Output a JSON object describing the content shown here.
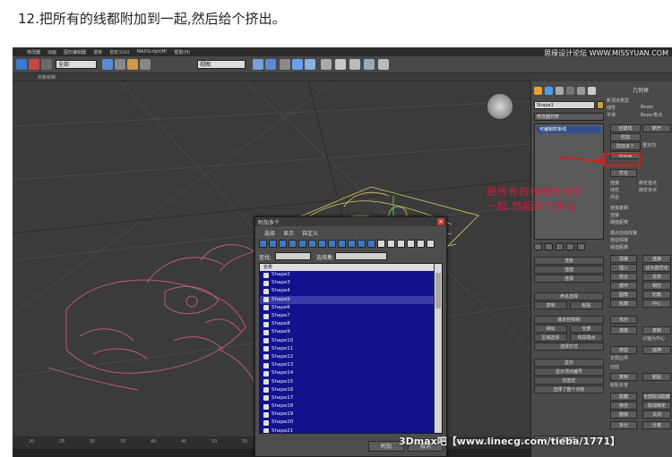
{
  "caption": "12.把所有的线都附加到一起,然后给个挤出。",
  "watermark_top": "思缘设计论坛 WWW.MISSYUAN.COM",
  "watermark_bottom": "3Dmax吧【www.linecg.com/tieba/1771】",
  "annotation": "把所有的线都附加到一起,然后给个挤出",
  "menubar": {
    "items": [
      "修改器",
      "动画",
      "图形编辑器",
      "渲染",
      "自定义(U)",
      "MAXScript(M)",
      "帮助(H)"
    ]
  },
  "toolbar": {
    "select_filter": "全部",
    "view": "视图"
  },
  "subbar": {
    "label": "对象绘制"
  },
  "command_panel": {
    "rollout_title": "几何体",
    "object_name": "Shape1",
    "modifier_list": "修改器列表",
    "stack_item": "可编辑样条线",
    "right_items": [
      "新顶点类型",
      "线性",
      "Bezer",
      "平滑",
      "Bezer角点",
      "创建线",
      "断开",
      "附加",
      "附加多个",
      "重定向",
      "横截面",
      "优化",
      "连接",
      "线性",
      "绑定首点",
      "闭合",
      "绑定末点",
      "连接复制",
      "连接",
      "阈值距离",
      "端点自动焊接",
      "自动焊接",
      "阈值距离",
      "焊接",
      "连接",
      "插入",
      "设为首顶点",
      "熔合",
      "反转",
      "循环",
      "相交",
      "圆角",
      "切角",
      "轮廓",
      "中心",
      "布尔",
      "镜像",
      "复制",
      "以轴为中心",
      "修剪",
      "延伸",
      "无限边界",
      "切线",
      "复制",
      "粘贴",
      "粘贴长度",
      "隐藏",
      "全部取消隐藏",
      "绑定",
      "取消绑定",
      "删除",
      "关闭",
      "拆分",
      "分离"
    ],
    "left_items": [
      "渲染",
      "插值",
      "选择",
      "命名选择",
      "复制",
      "粘贴",
      "锁定控制柄",
      "相似",
      "全部",
      "区域选择",
      "线段端点",
      "选择方式",
      "显示",
      "显示顶点编号",
      "仅选定",
      "选择了整个对象",
      "软选择"
    ]
  },
  "ruler": {
    "ticks": [
      "20",
      "25",
      "30",
      "35",
      "40",
      "45",
      "50",
      "55",
      "60",
      "65",
      "70",
      "75",
      "80",
      "85",
      "90",
      "95",
      "100"
    ]
  },
  "dialog": {
    "title": "附加多个",
    "menu": [
      "选择",
      "显示",
      "自定义"
    ],
    "search_label": "查找:",
    "search_value": "",
    "selection_set_label": "选择集:",
    "column_header": "名称",
    "items": [
      "Shape2",
      "Shape3",
      "Shape4",
      "Shape5",
      "Shape6",
      "Shape7",
      "Shape8",
      "Shape9",
      "Shape10",
      "Shape11",
      "Shape12",
      "Shape13",
      "Shape14",
      "Shape15",
      "Shape16",
      "Shape17",
      "Shape18",
      "Shape19",
      "Shape20",
      "Shape21"
    ],
    "ok_label": "附加",
    "cancel_label": "取消"
  },
  "colors": {
    "annotation_red": "#d8193a",
    "list_blue": "#11128c",
    "shape_pink": "#c75b8a",
    "shape_yellow": "#d9c76a"
  }
}
